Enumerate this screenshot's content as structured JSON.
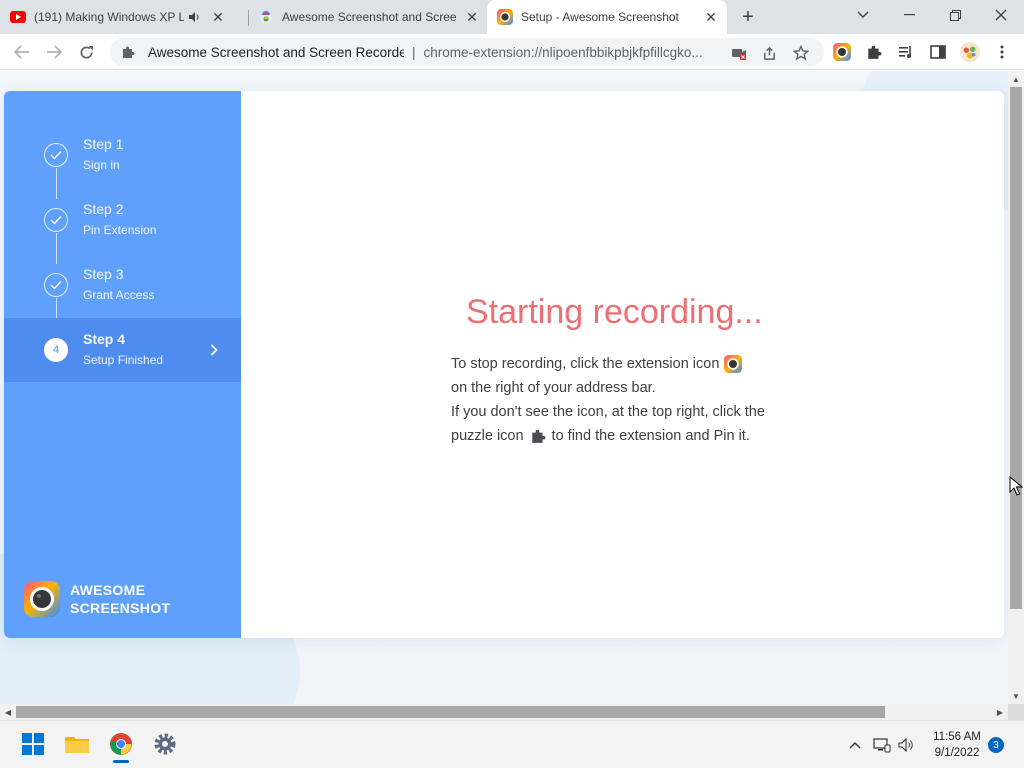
{
  "browser": {
    "tabs": [
      {
        "title": "(191) Making Windows XP Lo",
        "favicon": "youtube-icon",
        "has_audio": true,
        "active": false
      },
      {
        "title": "Awesome Screenshot and Screen",
        "favicon": "chrome-webstore-icon",
        "active": false
      },
      {
        "title": "Setup - Awesome Screenshot",
        "favicon": "awesome-screenshot-icon",
        "active": true
      }
    ],
    "omnibox": {
      "site_name": "Awesome Screenshot and Screen Recorde",
      "separator": "|",
      "url": "chrome-extension://nlipoenfbbikpbjkfpfillcgko..."
    }
  },
  "sidebar": {
    "steps": [
      {
        "title": "Step 1",
        "subtitle": "Sign in",
        "state": "done"
      },
      {
        "title": "Step 2",
        "subtitle": "Pin Extension",
        "state": "done"
      },
      {
        "title": "Step 3",
        "subtitle": "Grant Access",
        "state": "done"
      },
      {
        "title": "Step 4",
        "subtitle": "Setup Finished",
        "state": "current",
        "number": "4"
      }
    ],
    "brand": {
      "line1": "AWESOME",
      "line2": "SCREENSHOT"
    }
  },
  "main": {
    "heading": "Starting recording...",
    "line1": "To stop recording, click the extension icon",
    "line2": "on the right of your address bar.",
    "line3": "If you don't see the icon, at the top right, click the",
    "line4_pre": "puzzle icon",
    "line4_post": "to find the extension and Pin it."
  },
  "taskbar": {
    "clock_time": "11:56 AM",
    "clock_date": "9/1/2022",
    "notification_count": "3"
  },
  "colors": {
    "sidebar": "#5ea0fb",
    "sidebar_active": "#4f8cf0",
    "heading": "#ee6e73"
  }
}
